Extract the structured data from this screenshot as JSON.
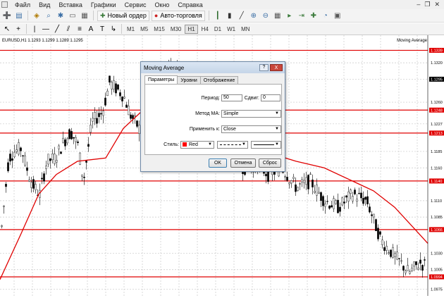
{
  "menu": {
    "items": [
      "Файл",
      "Вид",
      "Вставка",
      "Графики",
      "Сервис",
      "Окно",
      "Справка"
    ]
  },
  "toolbar": {
    "new_order": "Новый ордер",
    "autotrading": "Авто-торговля"
  },
  "timeframes": [
    "M1",
    "M5",
    "M15",
    "M30",
    "H1",
    "H4",
    "D1",
    "W1",
    "MN"
  ],
  "active_timeframe": "H1",
  "chart": {
    "info": "EURUSD,H1  1.1293 1.1299 1.1289 1.1295",
    "indicator": "Moving Average",
    "price_labels": [
      "1.1339",
      "1.1320",
      "1.1295",
      "1.1260",
      "1.1248",
      "1.1227",
      "1.1213",
      "1.1185",
      "1.1160",
      "1.1140",
      "1.1110",
      "1.1085",
      "1.1066",
      "1.1030",
      "1.1005",
      "1.0994",
      "1.0975"
    ],
    "highlight_labels": [
      "1.1339",
      "1.1248",
      "1.1213",
      "1.1140",
      "1.1066",
      "1.0994"
    ],
    "current_price": "1.1295",
    "line_color": "#e00000"
  },
  "dialog": {
    "title": "Moving Average",
    "help": "?",
    "close": "X",
    "tabs": [
      "Параметры",
      "Уровни",
      "Отображение"
    ],
    "period_label": "Период:",
    "period_value": "50",
    "shift_label": "Сдвиг:",
    "shift_value": "0",
    "method_label": "Метод MA:",
    "method_value": "Simple",
    "apply_label": "Применить к:",
    "apply_value": "Close",
    "style_label": "Стиль:",
    "style_color": "Red",
    "ok": "OK",
    "cancel": "Отмена",
    "reset": "Сброс"
  }
}
